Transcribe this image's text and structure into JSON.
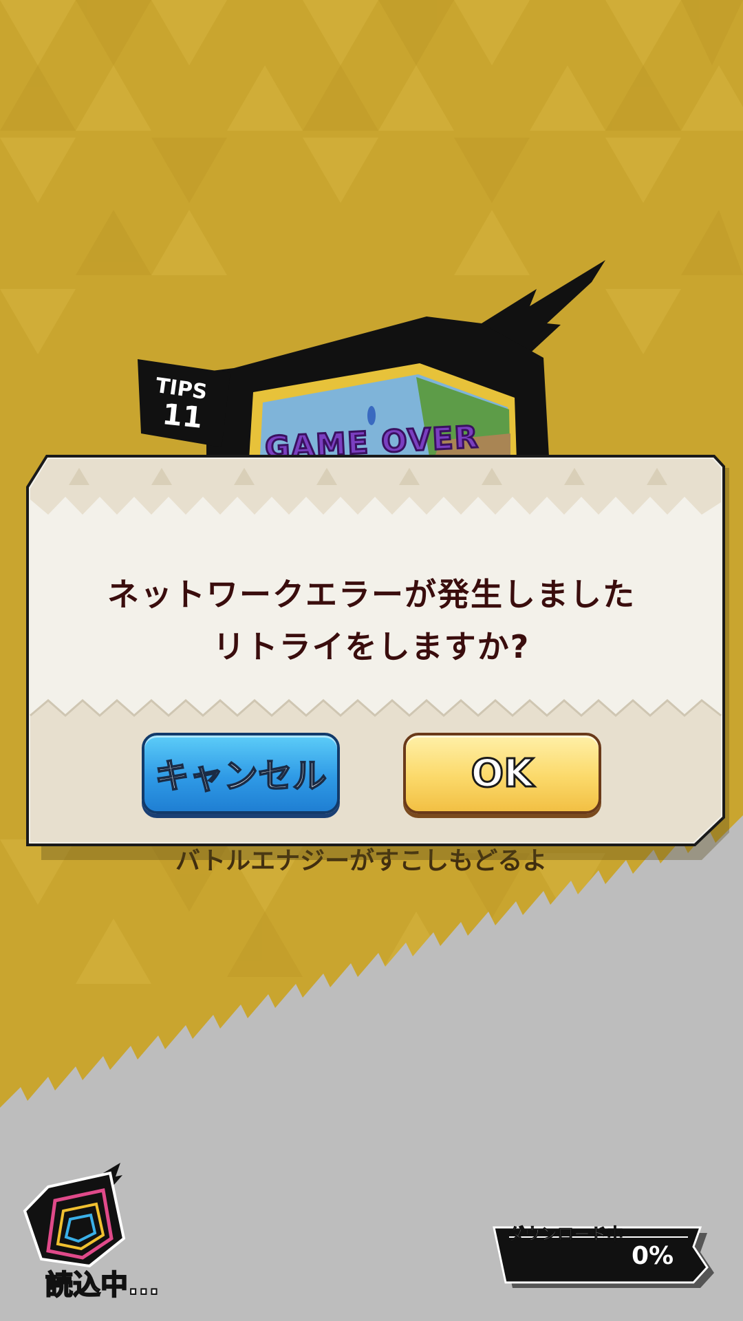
{
  "tips": {
    "label": "TIPS",
    "number": "11",
    "image_caption": "GAME OVER",
    "hint_text": "バトルエナジーがすこしもどるよ"
  },
  "dialog": {
    "message_line1": "ネットワークエラーが発生しました",
    "message_line2": "リトライをしますか?",
    "cancel_label": "キャンセル",
    "ok_label": "OK"
  },
  "loading": {
    "label": "読込中..."
  },
  "download": {
    "label": "ダウンロード中",
    "percent_text": "0%",
    "progress": 0
  },
  "colors": {
    "background": "#c9a52f",
    "dialog_body": "#f3f1ea",
    "dialog_band": "#e7dfce",
    "cancel_button": "#2f9ae6",
    "ok_button": "#fbd96a",
    "message_text": "#3a0d0d",
    "bottom_band": "#bdbdbd"
  },
  "icons": [
    "loading-logo-icon",
    "lightning-bolt-icon"
  ]
}
